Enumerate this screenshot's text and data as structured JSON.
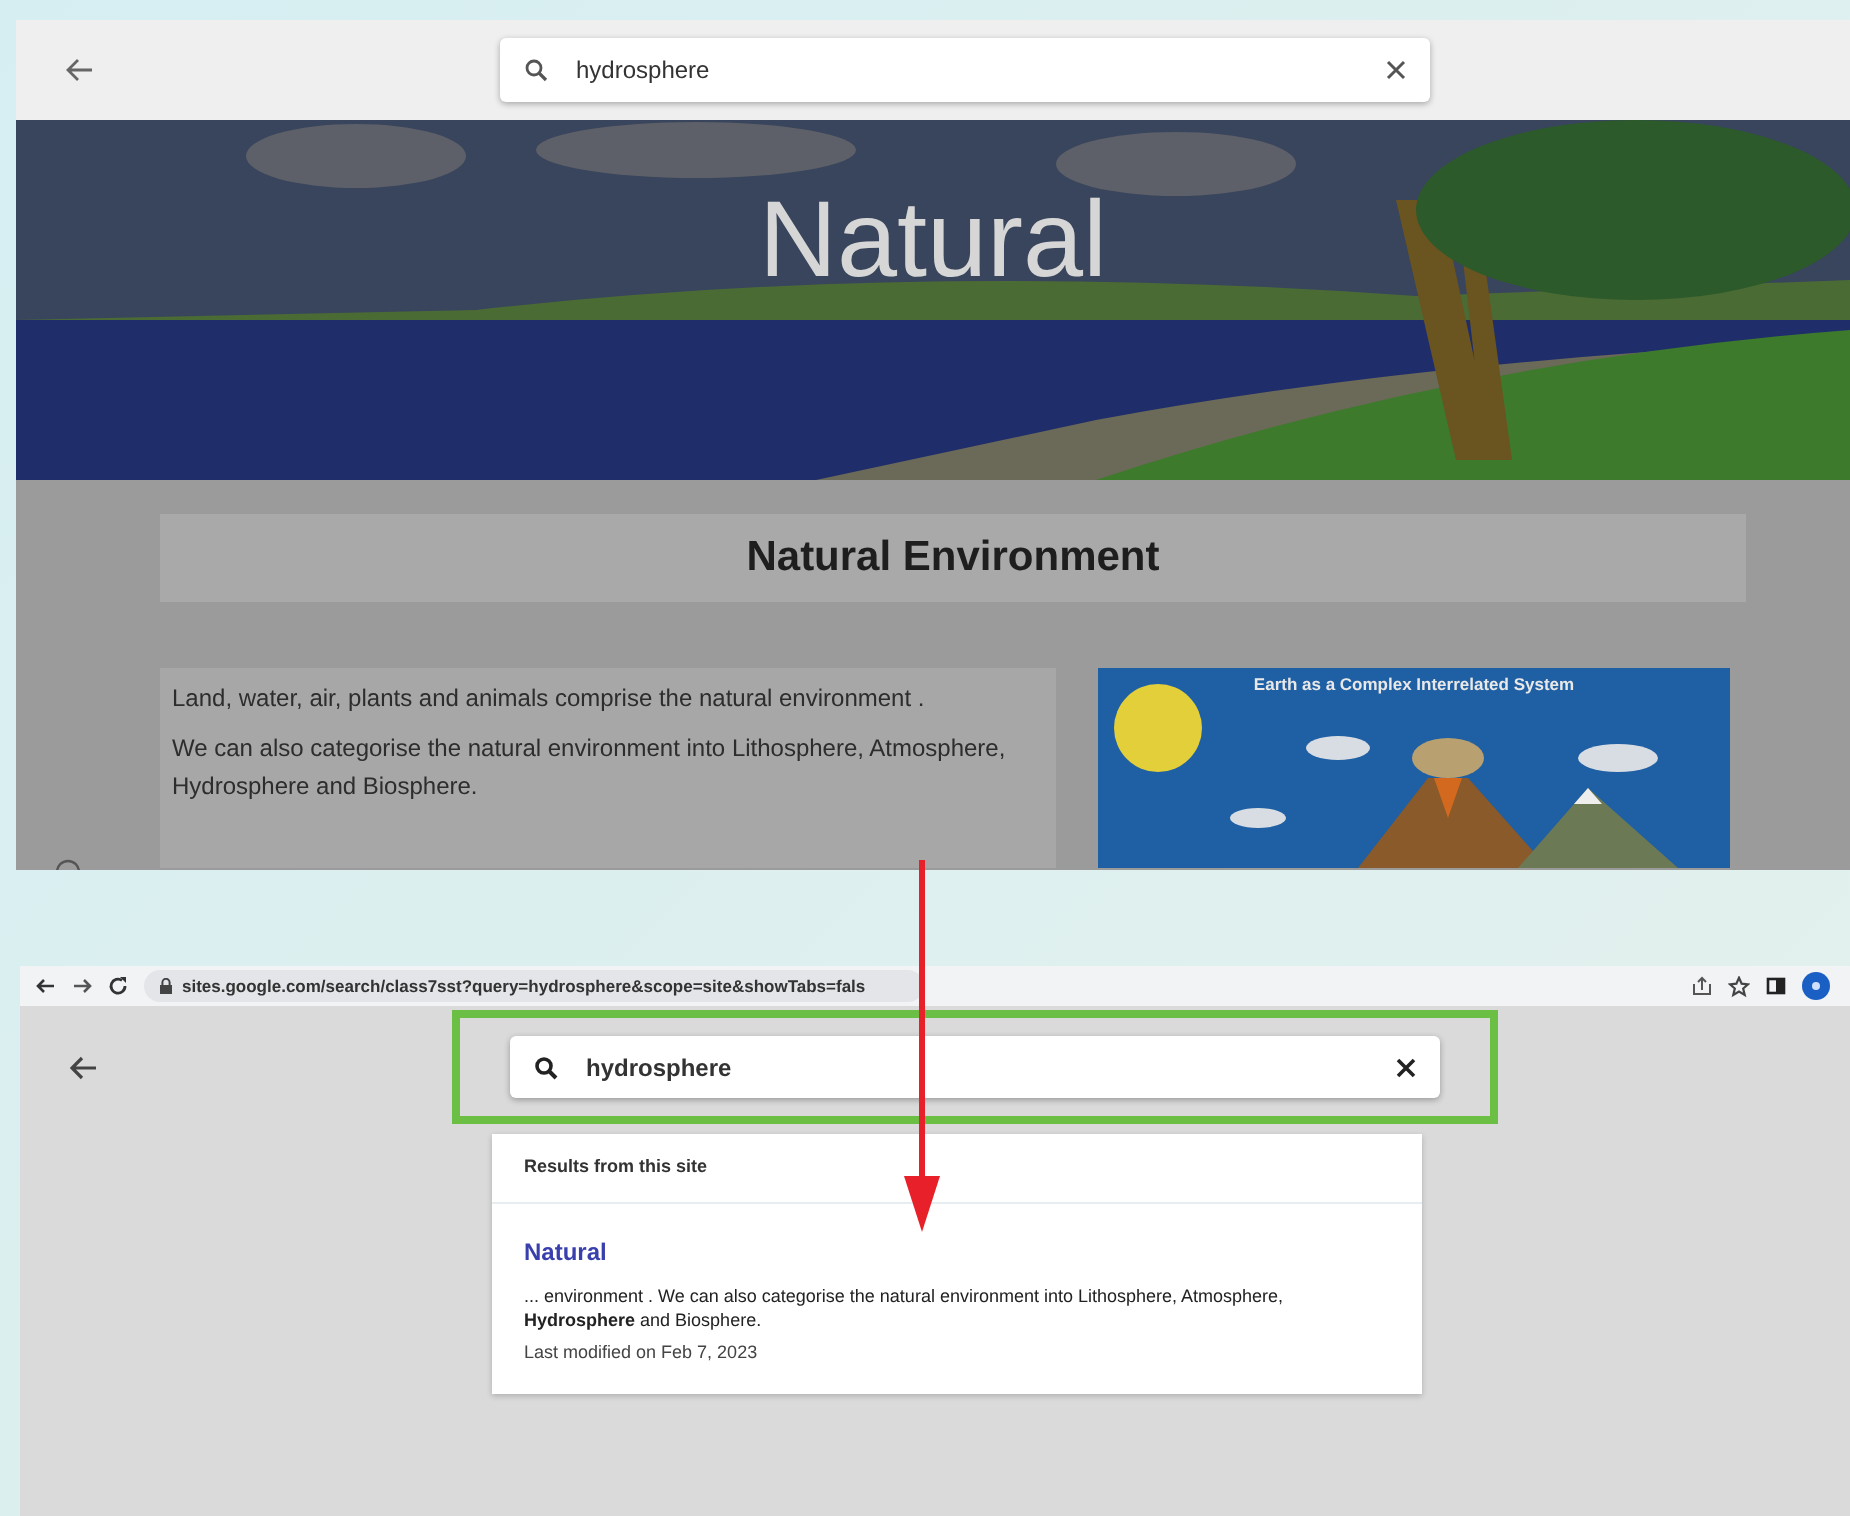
{
  "top_screen": {
    "search": {
      "value": "hydrosphere"
    },
    "banner": {
      "kind": "picture",
      "title": "Natural"
    },
    "heading": "Natural Environment",
    "paragraphs": [
      "Land, water, air, plants and animals comprise the natural environment .",
      "We can also categorise the natural environment into Lithosphere, Atmosphere, Hydrosphere and Biosphere."
    ],
    "figure": {
      "kind": "picture",
      "title": "Earth as a Complex Interrelated System"
    }
  },
  "bottom_screen": {
    "address": "sites.google.com/search/class7sst?query=hydrosphere&scope=site&showTabs=fals",
    "search": {
      "value": "hydrosphere",
      "highlighted": true
    },
    "results": {
      "header": "Results from this site",
      "items": [
        {
          "title": "Natural",
          "snippet": "... environment . We can also categorise the natural environment into Lithosphere, Atmosphere, **Hydrosphere** and Biosphere.",
          "modified": "Last modified on Feb 7, 2023"
        }
      ]
    }
  }
}
